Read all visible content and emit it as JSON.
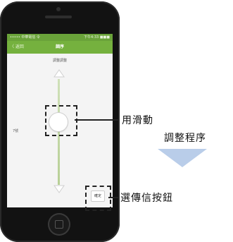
{
  "screen": {
    "status_left": "••••• 中華電信 令",
    "status_right": "下午4:33 ■■■",
    "back_label": "〈 返回",
    "title": "調序",
    "label": "調整調整",
    "side_label": "7號",
    "confirm_label": "確定"
  },
  "annotations": {
    "slider_line1": "用滑動",
    "slider_line2": "調整程序",
    "button": "選傳信按鈕"
  },
  "colors": {
    "nav_green": "#75b13e",
    "status_green": "#6aa33a",
    "arrow_blue": "#b9cde9"
  },
  "icons": {
    "up_arrow": "triangle-up-icon",
    "down_arrow": "triangle-down-icon",
    "callout_arrow": "arrow-down-icon"
  }
}
